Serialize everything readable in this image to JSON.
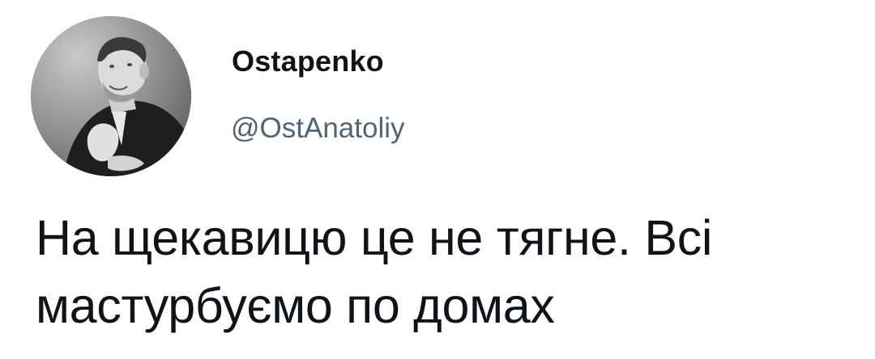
{
  "tweet": {
    "author": {
      "display_name": "Ostapenko",
      "handle": "@OstAnatoliy",
      "avatar_icon": "profile-photo"
    },
    "text": "На щекавицю це не тягне. Всі мастурбуємо по домах"
  },
  "colors": {
    "text_primary": "#0f1419",
    "text_secondary": "#536471",
    "background": "#ffffff"
  }
}
